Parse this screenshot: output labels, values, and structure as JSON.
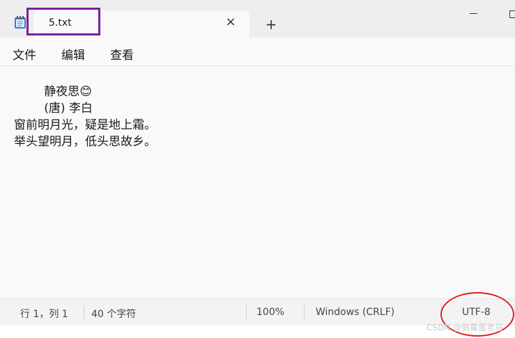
{
  "tab": {
    "title": "5.txt"
  },
  "window": {
    "new_tab": "+",
    "close_tab": "×"
  },
  "menu": {
    "file": "文件",
    "edit": "编辑",
    "view": "查看"
  },
  "document": {
    "lines": [
      "        静夜思😊",
      "        (唐) 李白",
      "窗前明月光，疑是地上霜。",
      "举头望明月，低头思故乡。"
    ]
  },
  "status": {
    "position": "行 1，列 1",
    "char_count": "40 个字符",
    "zoom": "100%",
    "line_ending": "Windows (CRLF)",
    "encoding": "UTF-8"
  },
  "watermark": "CSDN @倒霉蛋老马",
  "colors": {
    "annotation_purple": "#7a1f9e",
    "annotation_red": "#e02020",
    "background": "#f9f9f9"
  }
}
